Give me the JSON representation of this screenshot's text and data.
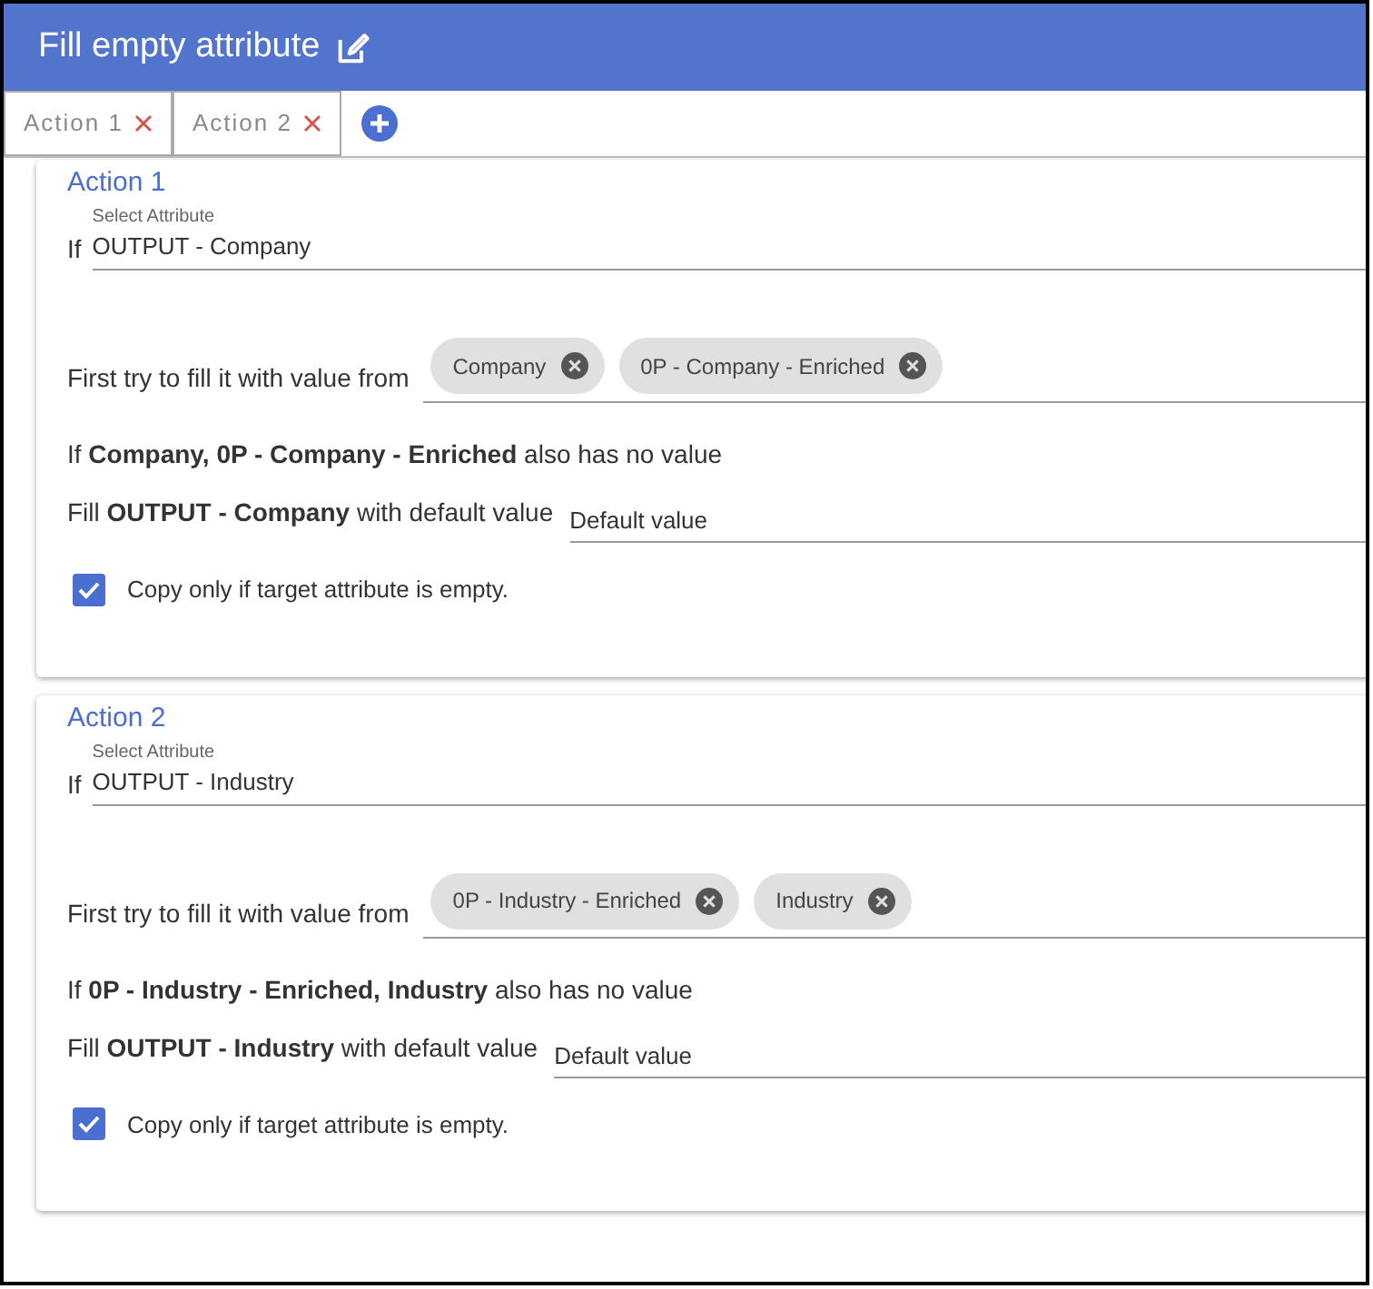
{
  "header": {
    "title": "Fill empty attribute"
  },
  "tabs": [
    {
      "label": "Action 1",
      "selected": false
    },
    {
      "label": "Action 2",
      "selected": false
    }
  ],
  "actions": [
    {
      "title": "Action 1",
      "if_label": "If",
      "attribute": {
        "label": "Select Attribute",
        "value": "OUTPUT - Company"
      },
      "sources_label": "First try to fill it with value from",
      "sources": [
        "Company",
        "0P - Company - Enriched"
      ],
      "fallback_text": "If **Company, 0P - Company - Enriched** also has no value",
      "default_label": "Fill **OUTPUT - Company** with default value",
      "default_value": "Default value",
      "copy_only_if_empty": {
        "label": "Copy only if target attribute is empty.",
        "checked": true
      }
    },
    {
      "title": "Action 2",
      "if_label": "If",
      "attribute": {
        "label": "Select Attribute",
        "value": "OUTPUT - Industry"
      },
      "sources_label": "First try to fill it with value from",
      "sources": [
        "0P - Industry - Enriched",
        "Industry"
      ],
      "fallback_text": "If **0P - Industry - Enriched, Industry** also has no value",
      "default_label": "Fill **OUTPUT - Industry** with default value",
      "default_value": "Default value",
      "copy_only_if_empty": {
        "label": "Copy only if target attribute is empty.",
        "checked": true
      }
    }
  ]
}
